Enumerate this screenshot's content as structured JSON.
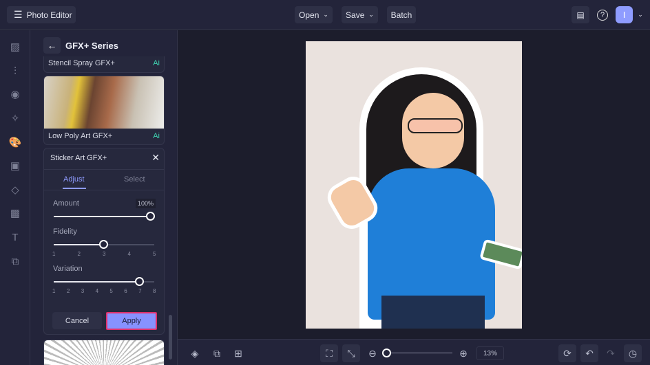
{
  "header": {
    "app_title": "Photo Editor",
    "open_label": "Open",
    "save_label": "Save",
    "batch_label": "Batch",
    "avatar_initial": "I"
  },
  "rail": {
    "icons": [
      "image-icon",
      "adjust-sliders-icon",
      "eye-icon",
      "sparkle-icon",
      "palette-icon",
      "frame-icon",
      "shapes-icon",
      "texture-icon",
      "text-icon",
      "overlay-icon"
    ]
  },
  "panel": {
    "title": "GFX+ Series",
    "items": [
      {
        "label": "Stencil Spray GFX+",
        "badge": "Ai"
      },
      {
        "label": "Low Poly Art GFX+",
        "badge": "Ai"
      }
    ],
    "active_effect": {
      "title": "Sticker Art GFX+",
      "tabs": [
        "Adjust",
        "Select"
      ],
      "active_tab": "Adjust",
      "amount": {
        "label": "Amount",
        "value": "100%",
        "fraction": 1.0
      },
      "fidelity": {
        "label": "Fidelity",
        "ticks": [
          "1",
          "2",
          "3",
          "4",
          "5"
        ],
        "value": 3
      },
      "variation": {
        "label": "Variation",
        "ticks": [
          "1",
          "2",
          "3",
          "4",
          "5",
          "6",
          "7",
          "8"
        ],
        "value": 7
      },
      "cancel_label": "Cancel",
      "apply_label": "Apply"
    }
  },
  "bottom": {
    "zoom_value": "13%",
    "zoom_fraction": 0.02
  },
  "colors": {
    "accent": "#7b8cff",
    "apply_border": "#e0306a",
    "ai_badge": "#3fd1b0"
  }
}
